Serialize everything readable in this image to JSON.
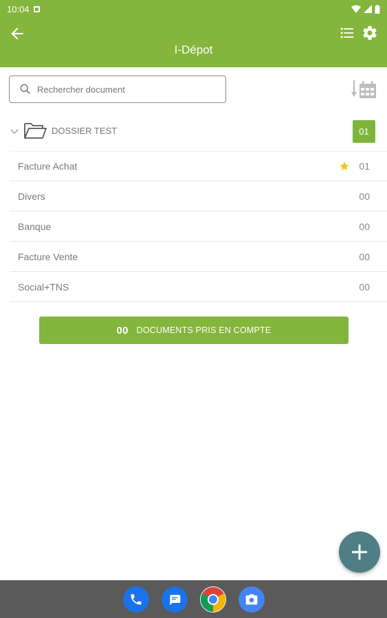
{
  "status_bar": {
    "time": "10:04"
  },
  "app_bar": {
    "title": "I-Dépot"
  },
  "search": {
    "placeholder": "Rechercher document"
  },
  "folder": {
    "name": "DOSSIER TEST",
    "count": "01"
  },
  "categories": [
    {
      "label": "Facture Achat",
      "count": "01",
      "starred": true
    },
    {
      "label": "Divers",
      "count": "00",
      "starred": false
    },
    {
      "label": "Banque",
      "count": "00",
      "starred": false
    },
    {
      "label": "Facture Vente",
      "count": "00",
      "starred": false
    },
    {
      "label": "Social+TNS",
      "count": "00",
      "starred": false
    }
  ],
  "documents_bar": {
    "count": "00",
    "label": "DOCUMENTS PRIS EN COMPTE"
  },
  "colors": {
    "accent": "#84b53d",
    "fab": "#4e7f85",
    "star": "#f5c518",
    "nav_bar": "#5a5a5a"
  },
  "icons": {
    "back": "arrow-left-icon",
    "list": "list-icon",
    "settings": "gear-icon",
    "search": "search-icon",
    "sort": "sort-by-date-icon",
    "folder": "folder-open-icon",
    "expand": "chevron-down-icon",
    "star": "star-icon",
    "fab": "plus-icon"
  },
  "dock": [
    "phone-icon",
    "messages-icon",
    "chrome-icon",
    "camera-icon"
  ]
}
